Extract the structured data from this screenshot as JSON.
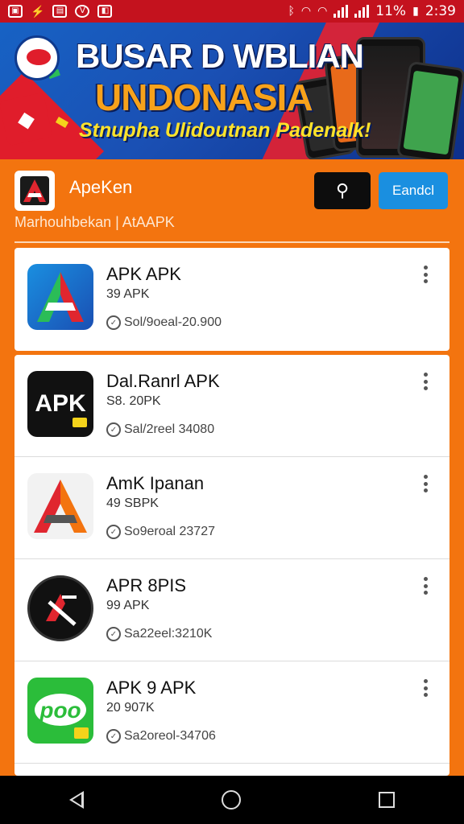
{
  "status_bar": {
    "battery": "11%",
    "time": "2:39"
  },
  "banner": {
    "line1": "BUSAR D WBLIAN",
    "line2": "UNDONASIA",
    "line3": "Stnupha Ulidoutnan Padenalk!"
  },
  "header": {
    "app_name": "ApeKen",
    "action_button": "Eandcl",
    "subtitle": "Marhouhbekan | AtAAPK"
  },
  "apps": [
    {
      "title": "APK APK",
      "size": "39 APK",
      "meta": "Sol/9oeal-20.900",
      "icon_label": "A"
    },
    {
      "title": "Dal.Ranrl APK",
      "size": "S8. 20PK",
      "meta": "Sal/2reel 34080",
      "icon_label": "APK"
    },
    {
      "title": "AmK Ipanan",
      "size": "49 SBPK",
      "meta": "So9eroal 23727",
      "icon_label": "A"
    },
    {
      "title": "APR 8PIS",
      "size": "99 APK",
      "meta": "Sa22eel:3210K",
      "icon_label": ""
    },
    {
      "title": "APK 9 APK",
      "size": "20 907K",
      "meta": "Sa2oreol-34706",
      "icon_label": "poo"
    }
  ],
  "colors": {
    "status_bar": "#c4121e",
    "background": "#f3740f",
    "action_button": "#1a8fe0"
  }
}
